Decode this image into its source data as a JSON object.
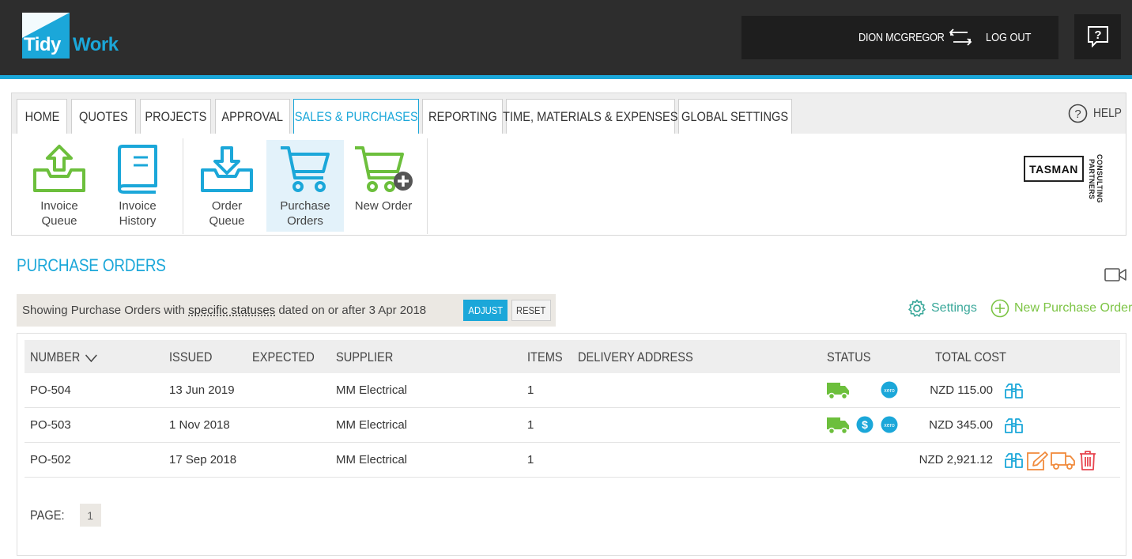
{
  "app": {
    "logo_word1": "Tidy",
    "logo_word2": "Work",
    "user_name": "DION MCGREGOR",
    "logout_label": "LOG OUT"
  },
  "nav": {
    "tabs": [
      {
        "label": "HOME"
      },
      {
        "label": "QUOTES"
      },
      {
        "label": "PROJECTS"
      },
      {
        "label": "APPROVAL"
      },
      {
        "label": "SALES & PURCHASES",
        "active": true
      },
      {
        "label": "REPORTING"
      },
      {
        "label": "TIME, MATERIALS & EXPENSES"
      },
      {
        "label": "GLOBAL SETTINGS"
      }
    ],
    "help_label": "HELP",
    "tools": [
      {
        "line1": "Invoice",
        "line2": "Queue"
      },
      {
        "line1": "Invoice",
        "line2": "History"
      },
      {
        "line1": "Order",
        "line2": "Queue"
      },
      {
        "line1": "Purchase",
        "line2": "Orders",
        "selected": true
      },
      {
        "line1": "New Order",
        "line2": ""
      }
    ],
    "company_logo": {
      "name": "TASMAN",
      "line1": "CONSULTING",
      "line2": "PARTNERS"
    }
  },
  "page": {
    "title": "PURCHASE ORDERS",
    "filter": {
      "prefix": "Showing Purchase Orders with",
      "link": "specific statuses",
      "suffix": "dated on or after 3 Apr 2018",
      "adjust_label": "ADJUST",
      "reset_label": "RESET"
    },
    "settings_label": "Settings",
    "new_po_label": "New Purchase Order"
  },
  "table": {
    "headers": {
      "number": "NUMBER",
      "issued": "ISSUED",
      "expected": "EXPECTED",
      "supplier": "SUPPLIER",
      "items": "ITEMS",
      "delivery": "DELIVERY ADDRESS",
      "status": "STATUS",
      "total": "TOTAL COST"
    },
    "rows": [
      {
        "number": "PO-504",
        "issued": "13 Jun 2019",
        "expected": "",
        "supplier": "MM Electrical",
        "items": "1",
        "delivery": "",
        "total": "NZD 115.00",
        "status_icons": [
          "delivered-truck-icon",
          "xero-icon"
        ],
        "actions": [
          "view-icon"
        ]
      },
      {
        "number": "PO-503",
        "issued": "1 Nov 2018",
        "expected": "",
        "supplier": "MM Electrical",
        "items": "1",
        "delivery": "",
        "total": "NZD 345.00",
        "status_icons": [
          "delivered-truck-icon",
          "paid-dollar-icon",
          "xero-icon"
        ],
        "actions": [
          "view-icon"
        ]
      },
      {
        "number": "PO-502",
        "issued": "17 Sep 2018",
        "expected": "",
        "supplier": "MM Electrical",
        "items": "1",
        "delivery": "",
        "total": "NZD 2,921.12",
        "status_icons": [],
        "actions": [
          "view-icon",
          "edit-icon",
          "receive-truck-icon",
          "delete-icon"
        ]
      }
    ],
    "page_label": "PAGE:",
    "current_page": "1"
  },
  "colors": {
    "accent_blue": "#1ba7d9",
    "green": "#7cc444",
    "teal": "#3aa89a",
    "orange": "#f08a3c",
    "red": "#e8454f",
    "topbar": "#2d2d2d"
  }
}
